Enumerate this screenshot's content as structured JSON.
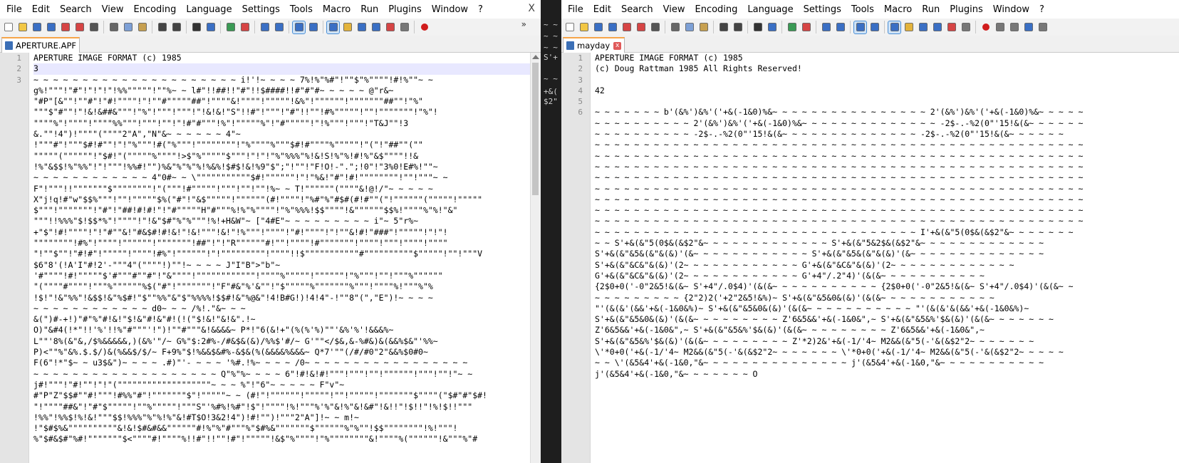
{
  "menus": [
    "File",
    "Edit",
    "Search",
    "View",
    "Encoding",
    "Language",
    "Settings",
    "Tools",
    "Macro",
    "Run",
    "Plugins",
    "Window",
    "?"
  ],
  "left": {
    "close_glyph": "X",
    "overflow_glyph": "»",
    "tab_label": "APERTURE.APF",
    "lines": [
      {
        "n": "1",
        "t": "APERTURE IMAGE FORMAT (c) 1985"
      },
      {
        "n": "2",
        "t": "3",
        "cur": true
      },
      {
        "n": "3",
        "t": "~ ~ ~ ~ ~ ~ ~ ~ ~ ~ ~ ~ ~ ~ ~ ~ ~ ~ ~ ~ ~ i!'!~ ~ ~ ~ 7%!%\"%#\"!\"\"$\"%\"\"\"\"!#!%\"\"~ ~"
      },
      {
        "n": "",
        "t": "g%!\"\"\"!\"#\"!\"!\"!\"!%%\"\"\"\"\"!\"\"%~ ~ l#\"!!##!!\"#\"!!$####!!#\"#\"#~ ~ ~ ~ ~ @\"r&~"
      },
      {
        "n": "",
        "t": "\"#P\"[&\"\"!\"\"#\"!\"#!\"\"\"\"!\"!\"\"#\"\"\"\"\"##\"!\"\"\"\"&!\"\"\"\"!\"\"\"\"\"!&%\"!\"\"\"\"\"\"!\"\"\"\"\"\"\"##\"\"!\"%\""
      },
      {
        "n": "",
        "t": "\"\"\"$\"#\"\"!\"!&!&##&\"\"\"!\"%\"!\"\"\"!\"\"\"!\"!&!&!\"S\"!!#\"!\"\"\"!\"#\"!!\"\"!#%\"\"\"\"\"!\"\"!\"\"\"\"\"\"\"!\"%\"!"
      },
      {
        "n": "",
        "t": "\"\"\"\"%\"!\"\"\"\"!\"\"\"\"%%\"\"\"!\"\"\"!\"\"!\"!#\"#\"\"\"!%\"!\"\"\"\"\"%\"!\"#\"\"\"\"\"!\"!%\"\"\"!\"\"\"!\"T&J\"\"!3"
      },
      {
        "n": "",
        "t": "&.\"\"!4\")!\"\"\"\"(\"\"\"\"2\"A\",\"N\"&~ ~ ~ ~ ~ ~ 4\"~"
      },
      {
        "n": "",
        "t": "!\"\"\"#\"!\"\"\"$#!#\"\"!\"!\"%\"\"\"!#(\"%\"\"\"!\"\"\"\"\"\"\"\"!\"%\"\"\"\"%\"\"\"$#!#\"\"\"\"%\"\"\"\"\"!\"(\"!\"##\"\"(\"\""
      },
      {
        "n": "",
        "t": "\"\"\"\"\"(\"\"\"\"\"\"!\"$#!\"(\"\"\"\"\"%\"\"\"\"!>$\"%\"\"\"\"\"$\"\"\"!\"!\"!\"%\"%%%\"%!&!S!%\"%!#!%\"&$\"\"\"\"!!&"
      },
      {
        "n": "",
        "t": "!%\"&$$!%\"%%\"!\"!\"\"\"!%%#!\"\")%&\"%\"%\"%!%&%!$#$!&!%9\"$\";\"!\"\"!\"F!O!-\".\";!0\"!\"3%0!E#%!\"\"~"
      },
      {
        "n": "",
        "t": "~ ~ ~ ~ ~ ~ ~ ~ ~ ~ ~ ~ 4\"0#~ ~ \\\"\"\"\"\"\"\"\"\"\"\"$#!\"\"\"\"\"\"!\"!\"%&!\"#\"!#!\"\"\"\"\"\"\"\"!\"\"!\"\"\"~ ~"
      },
      {
        "n": "",
        "t": "F\"!\"\"\"!!\"\"\"\"\"\"\"$\"\"\"\"\"\"\"\"!\"(\"\"\"!#\"\"\"\"\"!\"\"\"!\"\"!\"\"!%~ ~ T!\"\"\"\"\"\"(\"\"\"\"&!@!/\"~ ~ ~ ~ ~"
      },
      {
        "n": "",
        "t": "X\"j!q!#\"w\"$$%\"\"\"!\"\"!\"\"\"\"\"$%(\"#\"!\"&$\"\"\"\"\"!\"\"\"\"\"\"(#!\"\"\"\"!\"%#\"%\"#$#(#!#\"\"(\"!\"\"\"\"\"\"(\"\"\"\"\"!\"\"\"\"\""
      },
      {
        "n": "",
        "t": "$\"\"\"!\"\"\"\"\"\"\"!\"#\"!\"##!#!#!\"!\"#\"\"\"\"\"H\"#\"\"\"%!%\"%\"\"\"\"!\"%\"%%%!$$\"\"\"\"!&\"\"\"\"\"\"$$%!\"\"\"\"%\"%!\"&\""
      },
      {
        "n": "",
        "t": "\"\"\"!!%%%\"$!$$*%\"!\"\"\"\"!\"!&\"$#\"%\"%\"\"\"!%!+H&W\"~ [\"4#E\"~ ~ ~ ~ ~ ~ ~ ~ ~ i\"~ 5\"r%~"
      },
      {
        "n": "",
        "t": "+\"$\"!#!\"\"\"\"!\"!\"#\"\"&!\"#&$#!#!&!\"!&!\"\"\"!&!\"!%\"\"\"!\"\"\"\"!\"#!\"\"\"\"!\"!\"\"&!#!\"###\"!\"\"\"\"\"!\"!\"!"
      },
      {
        "n": "",
        "t": "\"\"\"\"\"\"\"\"!#%\"!\"\"\"\"!\"\"\"\"\"\"!\"\"\"\"\"\"\"!##\"!\"!\"R\"\"\"\"\"\"#!\"\"!\"\"\"\"!#\"\"\"\"\"\"\"!\"\"\"\"!\"\"\"!\"\"\"\"!\"\"\"\""
      },
      {
        "n": "",
        "t": "\"!\"\"$\"\"!\"#!#\"!\"\"\"\"\"!\"\"\"\"!#%\"!\"\"\"\"\"\"!\"!\"\"\"\"\"\"\"\"\"!\"\"\"\"!!$\"\"\"\"\"\"\"\"\"\"\"#\"\"\"\"\"\"\"\"\"\"$\"\"\"\"\"!\"\"!\"\"\"V"
      },
      {
        "n": "",
        "t": "$6\"8'(!A'I\"#!2'-\"\"\"4\"(\"\"\"\"!)\"\"!~ ~ ~ ~ J\"I\"B\">\"b\"~"
      },
      {
        "n": "",
        "t": "'#\"\"\"\"!#!\"\"\"\"\"$'#\"\"\"#\"\"#\"!\"&\"\"\"\"!\"\"\"\"\"\"\"\"\"\"\"\"!\"\"\"\"%\"\"\"\"\"!\"\"\"\"\"\"!\"%\"\"\"!\"\"!\"\"\"%\"\"\"\"\"\""
      },
      {
        "n": "",
        "t": "\"(\"\"\"\"#\"\"\"\"!\"\"\"%\"\"\"\"\"\"%$(\"#\"!\"\"\"\"\"\"\"!\"F\"#&\"%'&\"\"!\"$\"\"\"\"\"%\"\"\"\"\"\"\"%\"\"\"!\"\"\"\"%!\"\"\"%\"%"
      },
      {
        "n": "",
        "t": "!$!\"!&\"%%\"!&$$!&\"%$#!\"$\"\"%%\"&\"$\"%%%%!$$#!&\"%@&\"!4!B#G!)!4!4\"-!\"\"8\"(\",\"E\")!~ ~ ~ ~"
      },
      {
        "n": "",
        "t": "~ ~ ~ ~ ~ ~ ~ ~ ~ ~ ~ ~ d0~ ~ ~ /%!.\"&~ ~ ~"
      },
      {
        "n": "",
        "t": "&(\")#-+!)\"#\"%\"#!&!\"$!&\"#!&\"#!(!(\"$!&!\"&!&\".!~"
      },
      {
        "n": "",
        "t": "O)\"&#4(!*\"!!'%'!!%\"#\"\"\"'!\")!\"\"#\"\"\"&!&&&&~ P*!\"6(&!+\"(%(%'%)\"\"'&%'%'!&&&%~"
      },
      {
        "n": "",
        "t": "L\"\"'8%(&\"&,/$%&&&&&,)(&%'\"/~ G%\"$:2#%-/#&$&(&)/%%$'#/~ G'\"\"</$&,&-%#&)&(&&%$&\"'%%~"
      },
      {
        "n": "",
        "t": "P)<\"\"%\"&%.$.$/)&(%&&$/$/~ F+9%\"$!%&&$&#%-&$&(%(&&&&%&&&~ Q*7'\"\"(/#/#0\"2\"&&%$0#0~"
      },
      {
        "n": "",
        "t": "F(6\"!*\"$~ ~ u3$&\")~ ~ ~ ~ .#)\"'- ~ ~ ~ '%#.!%~ ~ ~ ~ /0~ ~ ~ ~ ~ ~ ~ ~ ~ ~ ~ ~ ~ ~ ~ ~ ~"
      },
      {
        "n": "",
        "t": "~ ~ ~ ~ ~ ~ ~ ~ ~ ~ ~ ~ ~ ~ ~ ~ ~ ~ ~ Q\"%\"%~ ~ ~ ~ 6\"!#!&!#!\"\"\"!\"\"\"!\"\"!\"\"\"\"\"\"!\"\"\"!\"\"!\"~ ~"
      },
      {
        "n": "",
        "t": "j#!\"\"\"!\"#!\"\"!\"!\"(\"\"\"\"\"\"\"\"\"\"\"\"\"\"\"\"\"\"\"~ ~ ~ %\"!\"6\"~ ~ ~ ~ ~ F\"v\"~"
      },
      {
        "n": "",
        "t": "#\"P\"Z\"$$#\"\"#!\"\"\"!#%%\"#\"!\"\"\"\"\"\"\"$\"!\"\"\"\"\"~ ~ (#!\"!\"\"\"\"\"\"!\"\"\"\"\"!\"\"!\"\"\"\"\"!\"\"\"\"\"\"\"$\"\"\"\"(\"$#\"#\"$#!"
      },
      {
        "n": "",
        "t": "\"!\"\"\"\"##&\"!\"#\"$\"\"\"\"\"!\"\"%\"\"\"\"\"!\"\"\"S\"'%#%!%#\"!$\"!\"\"\"\"!%!\"\"\"%'%\"&!%\"&!&#\"!&!!\"!$!!\"!%!$!!\"\"\""
      },
      {
        "n": "",
        "t": "!%%\"!%%$!%!&!\"\"\"$$!%%%\"%\"%!%\"&!#T$O!3&2!4\")!#!\"\")!\"\"\"2\"A\"]!~ ~ m!~"
      },
      {
        "n": "",
        "t": "!\"$#$%&\"\"\"\"\"\"\"\"\"\"&!&!$#&#&&\"\"\"\"\"\"#!%\"%\"#\"\"\"%\"$#%&\"\"\"\"\"\"\"$\"\"\"\"\"\"%\"%\"\"!$$\"\"\"\"\"\"\"\"!%!\"\"\"!"
      },
      {
        "n": "",
        "t": "%\"$#&$#\"%#!\"\"\"\"\"\"\"$<\"\"\"\"#!\"\"\"\"%!!#\"!!\"\"!#\"!\"\"\"\"\"!&$\"%\"\"\"\"!\"%\"\"\"\"\"\"\"\"&!\"\"\"\"%(\"\"\"\"\"\"!&\"\"\"%\"#"
      }
    ]
  },
  "right": {
    "tab_label": "mayday",
    "lines": [
      {
        "n": "1",
        "t": "APERTURE IMAGE FORMAT (c) 1985"
      },
      {
        "n": "2",
        "t": "(c) Doug Rattman 1985 All Rights Reserved!"
      },
      {
        "n": "3",
        "t": "",
        "cur": true
      },
      {
        "n": "4",
        "t": "42"
      },
      {
        "n": "5",
        "t": ""
      },
      {
        "n": "6",
        "t": "~ ~ ~ ~ ~ ~ ~ b'(&%')&%'('+&(-1&0)%&~ ~ ~ ~ ~ ~ ~ ~ ~ ~ ~ ~ ~ ~ ~ ~ 2'(&%')&%'('+&(-1&0)%&~ ~ ~ ~ ~"
      },
      {
        "n": "",
        "t": "~ ~ ~ ~ ~ ~ ~ ~ ~ ~ 2'(&%')&%'('+&(-1&0)%&~ ~ ~ ~ ~ ~ ~ ~ ~ ~ ~ ~ ~ ~ -2$-.-%2(0\"'15!&(&~ ~ ~ ~ ~ ~"
      },
      {
        "n": "",
        "t": "~ ~ ~ ~ ~ ~ ~ ~ ~ ~ -2$-.-%2(0\"'15!&(&~ ~ ~ ~ ~ ~ ~ ~ ~ ~ ~ ~ ~ ~ -2$-.-%2(0\"'15!&(&~ ~ ~ ~ ~ ~"
      },
      {
        "n": "",
        "t": "~ ~ ~ ~ ~ ~ ~ ~ ~ ~ ~ ~ ~ ~ ~ ~ ~ ~ ~ ~ ~ ~ ~ ~ ~ ~ ~ ~ ~ ~ ~ ~ ~ ~ ~ ~ ~ ~ ~ ~ ~ ~ ~ ~ ~ ~ ~ ~ ~ ~"
      },
      {
        "n": "",
        "t": "~ ~ ~ ~ ~ ~ ~ ~ ~ ~ ~ ~ ~ ~ ~ ~ ~ ~ ~ ~ ~ ~ ~ ~ ~ ~ ~ ~ ~ ~ ~ ~ ~ ~ ~ ~ ~ ~ ~ ~ ~ ~ ~ ~ ~ ~ ~ ~ ~ ~"
      },
      {
        "n": "",
        "t": "~ ~ ~ ~ ~ ~ ~ ~ ~ ~ ~ ~ ~ ~ ~ ~ ~ ~ ~ ~ ~ ~ ~ ~ ~ ~ ~ ~ ~ ~ ~ ~ ~ ~ ~ ~ ~ ~ ~ ~ ~ ~ ~ ~ ~ ~ ~ ~ ~ ~"
      },
      {
        "n": "",
        "t": "~ ~ ~ ~ ~ ~ ~ ~ ~ ~ ~ ~ ~ ~ ~ ~ ~ ~ ~ ~ ~ ~ ~ ~ ~ ~ ~ ~ ~ ~ ~ ~ ~ ~ ~ ~ ~ ~ ~ ~ ~ ~ ~ ~ ~ ~ ~ ~ ~ ~"
      },
      {
        "n": "",
        "t": "~ ~ ~ ~ ~ ~ ~ ~ ~ ~ ~ ~ ~ ~ ~ ~ ~ ~ ~ ~ ~ ~ ~ ~ ~ ~ ~ ~ ~ ~ ~ ~ ~ ~ ~ ~ ~ ~ ~ ~ ~ ~ ~ ~ ~ ~ ~ ~ ~ ~"
      },
      {
        "n": "",
        "t": "~ ~ ~ ~ ~ ~ ~ ~ ~ ~ ~ ~ ~ ~ ~ ~ ~ ~ ~ ~ ~ ~ ~ ~ ~ ~ ~ ~ ~ ~ ~ ~ ~ ~ ~ ~ ~ ~ ~ ~ ~ ~ ~ ~ ~ ~ ~ ~ ~ ~"
      },
      {
        "n": "",
        "t": "~ ~ ~ ~ ~ ~ ~ ~ ~ ~ ~ ~ ~ ~ ~ ~ ~ ~ ~ ~ ~ ~ ~ ~ ~ ~ ~ ~ ~ ~ ~ ~ ~ ~ ~ ~ ~ ~ ~ ~ ~ ~ ~ ~ ~ ~ ~ ~ ~ ~"
      },
      {
        "n": "",
        "t": "~ ~ ~ ~ ~ ~ ~ ~ ~ ~ ~ ~ ~ ~ ~ ~ ~ ~ ~ ~ ~ ~ ~ ~ ~ ~ ~ ~ ~ ~ ~ ~ ~ ~ ~ ~ ~ ~ ~ ~ ~ ~ ~ ~ ~ ~ ~ ~ ~ ~"
      },
      {
        "n": "",
        "t": "~ ~ ~ ~ ~ ~ ~ ~ ~ ~ ~ ~ ~ ~ ~ ~ ~ ~ ~ ~ ~ ~ ~ ~ ~ ~ ~ ~ ~ ~ ~ ~ ~ I'+&(&\"5(0$&(&$2\"&~ ~ ~ ~ ~ ~ ~"
      },
      {
        "n": "",
        "t": "~ ~ S'+&(&\"5(0$&(&$2\"&~ ~ ~ ~ ~ ~ ~ ~ ~ ~ ~ ~ ~ S'+&(&\"5&2$&(&$2\"&~ ~ ~ ~ ~ ~ ~ ~ ~ ~ ~ ~ ~"
      },
      {
        "n": "",
        "t": "S'+&(&\"&5&(&\"&(&)'(&~ ~ ~ ~ ~ ~ ~ ~ ~ ~ ~ ~ S'+&(&\"&5&(&\"&(&)'(&~ ~ ~ ~ ~ ~ ~ ~ ~ ~ ~ ~ ~ ~"
      },
      {
        "n": "",
        "t": "S'+&(&\"&C&\"&(&)'(2~ ~ ~ ~ ~ ~ ~ ~ ~ ~ ~ ~ G'+&(&\"&C&\"&(&)'(2~ ~ ~ ~ ~ ~ ~ ~ ~ ~ ~ ~ ~"
      },
      {
        "n": "",
        "t": "G'+&(&\"&C&\"&(&)'(2~ ~ ~ ~ ~ ~ ~ ~ ~ ~ ~ ~ G'+4\"/.2\"4)'(&(&~ ~ ~ ~ ~ ~ ~ ~ ~ ~ ~"
      },
      {
        "n": "",
        "t": "{2$0+0('-0\"2&5!&(&~ S'+4\"/.0$4)'(&(&~ ~ ~ ~ ~ ~ ~ ~ ~ ~ ~ {2$0+0('-0\"2&5!&(&~ S'+4\"/.0$4)'(&(&~ ~"
      },
      {
        "n": "",
        "t": "~ ~ ~ ~ ~ ~ ~ ~ ~ {2\"2)2('+2\"2&5!&%)~ S'+&(&\"&5&0&(&)'(&(&~ ~ ~ ~ ~ ~ ~ ~ ~ ~ ~ ~"
      },
      {
        "n": "",
        "t": "\"'(&(&'(&&'+&(-1&0&%)~ S'+&(&\"&5&0&(&)'(&(&~ ~ ~ ~ ~ ~ ~ ~ ~ ~ ~ \"'(&(&'&(&&'+&(-1&0&%)~"
      },
      {
        "n": "",
        "t": "S'+&(&\"&5&0&(&)'(&(&~ ~ ~ ~ ~ ~ ~ ~ ~ Z'6&5&&'+&(-1&0&\",~ S'+&(&\"&5&%'$&(&)'(&(&~ ~ ~ ~ ~ ~ ~"
      },
      {
        "n": "",
        "t": "Z'6&5&&'+&(-1&0&\",~ S'+&(&\"&5&%'$&(&)'(&(&~ ~ ~ ~ ~ ~ ~ ~ ~ Z'6&5&&'+&(-1&0&\",~"
      },
      {
        "n": "",
        "t": "S'+&(&\"&5&%'$&(&)'(&(&~ ~ ~ ~ ~ ~ ~ ~ ~ Z'*2)2&'+&(-1/'4~ M2&&(&\"5(-'&(&$2\"2~ ~ ~ ~ ~ ~ ~"
      },
      {
        "n": "",
        "t": "\\'*0+0('+&(-1/'4~ M2&&(&\"5(-'&(&$2\"2~ ~ ~ ~ ~ ~ ~ \\'*0+0('+&(-1/'4~ M2&&(&\"5(-'&(&$2\"2~ ~ ~ ~ ~"
      },
      {
        "n": "",
        "t": "~ ~ \\'(&5&4'+&(-1&0,\"&~ ~ ~ ~ ~ ~ ~ ~ ~ ~ ~ ~ ~ ~ ~ j'(&5&4'+&(-1&0,\"&~ ~ ~ ~ ~ ~ ~ ~ ~ ~ ~"
      },
      {
        "n": "",
        "t": "j'(&5&4'+&(-1&0,\"&~ ~ ~ ~ ~ ~ ~ O"
      }
    ]
  },
  "separator_fragments": [
    "~ ~",
    "~ ~",
    "~ ~",
    "S'+",
    "~ ~",
    "+&(",
    "$2\""
  ],
  "toolbar_icons": [
    "new-file",
    "open-file",
    "save-file",
    "save-all",
    "close-file",
    "close-all",
    "print",
    "sep",
    "cut",
    "copy",
    "paste",
    "sep",
    "undo",
    "redo",
    "sep",
    "find",
    "replace",
    "sep",
    "zoom-in",
    "zoom-out",
    "sep",
    "sync-vertical",
    "sync-horizontal",
    "sep",
    "word-wrap",
    "show-all-chars",
    "sep",
    "indent-guide",
    "udl",
    "doc-map",
    "func-list",
    "folder-workspace",
    "monitor",
    "sep",
    "record-macro",
    "stop-record",
    "play-macro",
    "run-macro-multiple",
    "save-macro"
  ],
  "colors": {
    "accent": "#f7a54a",
    "active_line": "#e8e8ff",
    "gutter": "#e4e4e4",
    "separator": "#1e1e1e"
  }
}
